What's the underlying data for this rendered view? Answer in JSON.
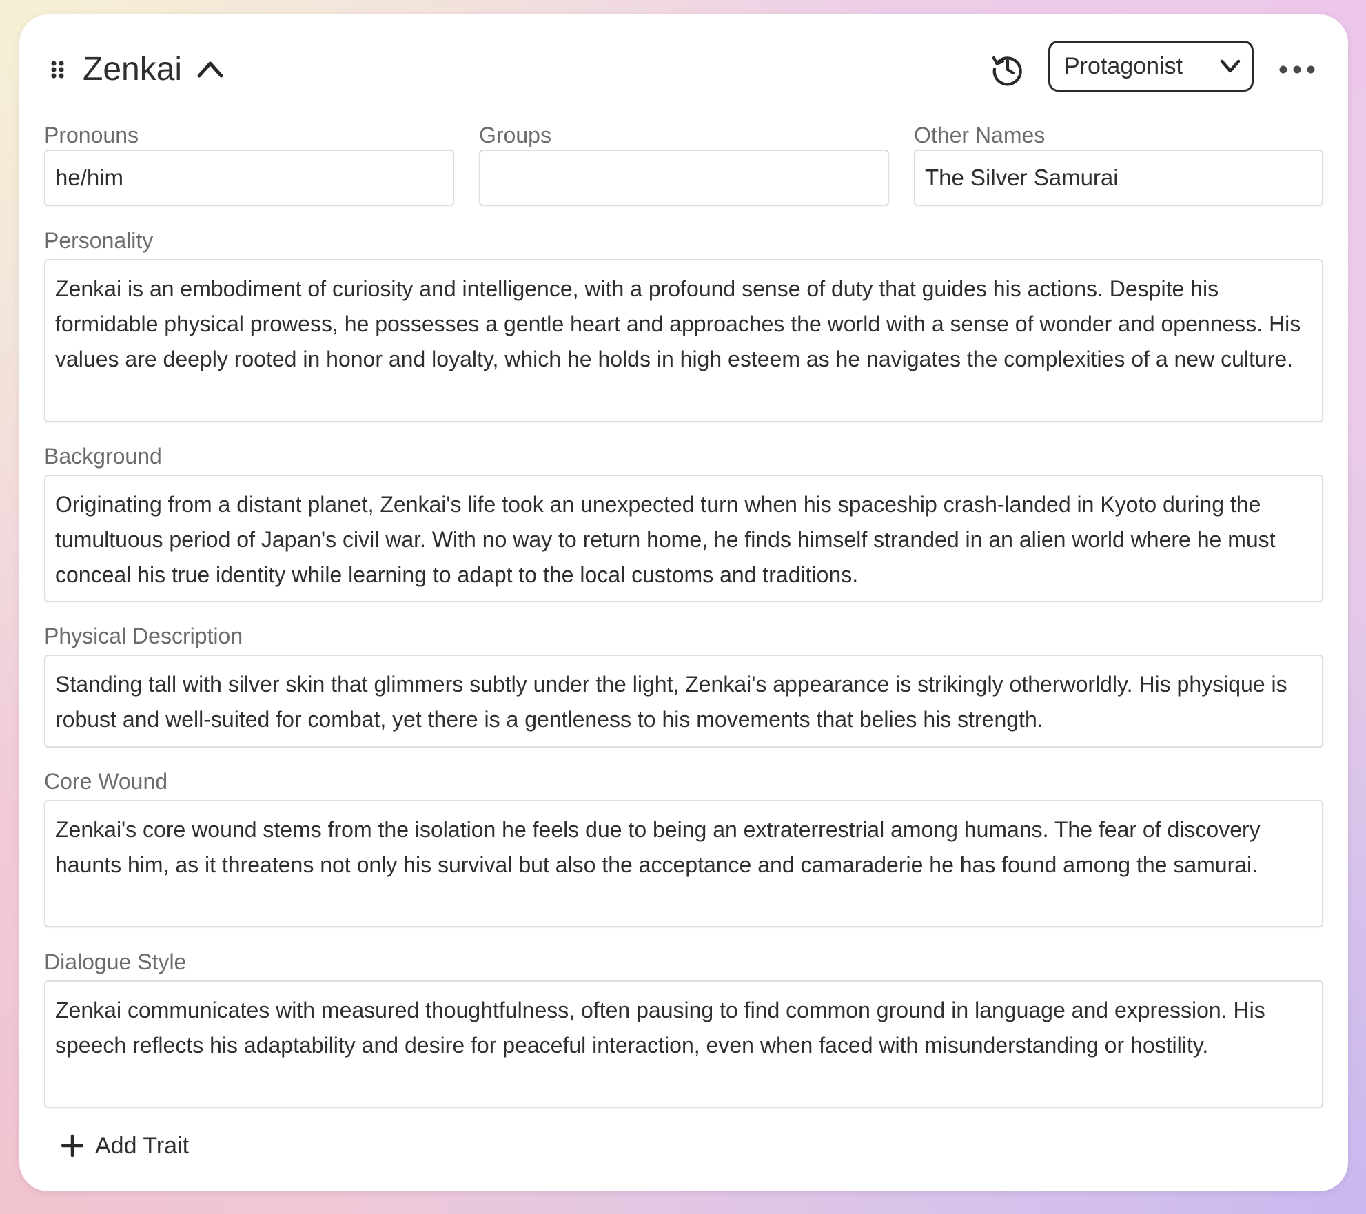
{
  "character": {
    "name": "Zenkai",
    "role": "Protagonist"
  },
  "icons": {
    "drag": "drag-handle-icon",
    "collapse": "chevron-up-icon",
    "history": "history-icon",
    "role_dropdown": "chevron-down-icon",
    "more": "more-horizontal-icon",
    "add": "plus-icon"
  },
  "fields": {
    "pronouns": {
      "label": "Pronouns",
      "value": "he/him"
    },
    "groups": {
      "label": "Groups",
      "value": ""
    },
    "other_names": {
      "label": "Other Names",
      "value": "The Silver Samurai"
    }
  },
  "traits": [
    {
      "label": "Personality",
      "value": "Zenkai is an embodiment of curiosity and intelligence, with a profound sense of duty that guides his actions. Despite his formidable physical prowess, he possesses a gentle heart and approaches the world with a sense of wonder and openness. His values are deeply rooted in honor and loyalty, which he holds in high esteem as he navigates the complexities of a new culture."
    },
    {
      "label": "Background",
      "value": "Originating from a distant planet, Zenkai's life took an unexpected turn when his spaceship crash-landed in Kyoto during the tumultuous period of Japan's civil war. With no way to return home, he finds himself stranded in an alien world where he must conceal his true identity while learning to adapt to the local customs and traditions."
    },
    {
      "label": "Physical Description",
      "value": "Standing tall with silver skin that glimmers subtly under the light, Zenkai's appearance is strikingly otherworldly. His physique is robust and well-suited for combat, yet there is a gentleness to his movements that belies his strength."
    },
    {
      "label": "Core Wound",
      "value": "Zenkai's core wound stems from the isolation he feels due to being an extraterrestrial among humans. The fear of discovery haunts him, as it threatens not only his survival but also the acceptance and camaraderie he has found among the samurai."
    },
    {
      "label": "Dialogue Style",
      "value": "Zenkai communicates with measured thoughtfulness, often pausing to find common ground in language and expression. His speech reflects his adaptability and desire for peaceful interaction, even when faced with misunderstanding or hostility."
    }
  ],
  "actions": {
    "add_trait": "Add Trait"
  },
  "colors": {
    "text": "#2f2f2f",
    "label": "#6c6c6c",
    "border": "#dedede",
    "card": "#ffffff"
  }
}
